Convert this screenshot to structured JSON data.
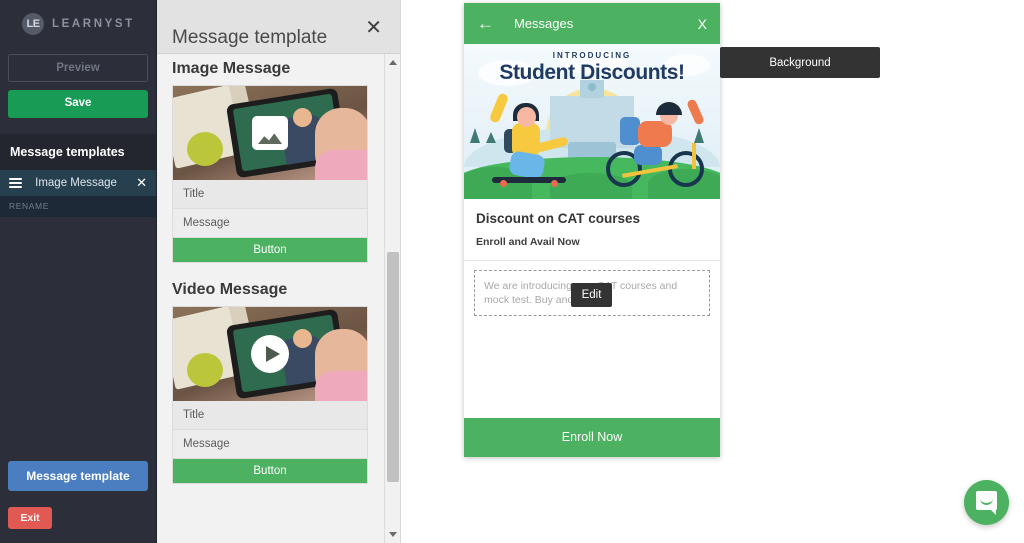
{
  "sidebar": {
    "brand": {
      "badge": "LE",
      "name": "LEARNYST"
    },
    "preview_label": "Preview",
    "save_label": "Save",
    "templates_header": "Message templates",
    "template_items": [
      {
        "label": "Image Message",
        "close": "✕",
        "rename_label": "RENAME"
      }
    ],
    "message_template_label": "Message template",
    "exit_label": "Exit"
  },
  "template_panel": {
    "title": "Message template",
    "close": "✕",
    "sections": [
      {
        "title": "Image Message",
        "thumb_icon": "image-icon",
        "title_row": "Title",
        "message_row": "Message",
        "button_label": "Button"
      },
      {
        "title": "Video Message",
        "thumb_icon": "play-icon",
        "title_row": "Title",
        "message_row": "Message",
        "button_label": "Button"
      }
    ]
  },
  "phone": {
    "header": {
      "back": "←",
      "title": "Messages",
      "close": "X"
    },
    "banner": {
      "kicker": "INTRODUCING",
      "title": "Student Discounts!"
    },
    "content": {
      "title": "Discount on CAT courses",
      "subtitle": "Enroll and Avail Now",
      "description": "We are introducing new CAT courses and mock test. Buy and avail 50"
    },
    "cta_label": "Enroll Now"
  },
  "tooltips": {
    "background": "Background",
    "edit": "Edit"
  },
  "widgets": {
    "intercom": "intercom-launcher"
  },
  "colors": {
    "sidebar_bg": "#2c2f3a",
    "save_green": "#189b55",
    "accent_green": "#4cb161",
    "blue_button": "#4a7ec0",
    "exit_red": "#e05a53",
    "tooltip_bg": "#333333",
    "banner_navy": "#1f3b63"
  }
}
